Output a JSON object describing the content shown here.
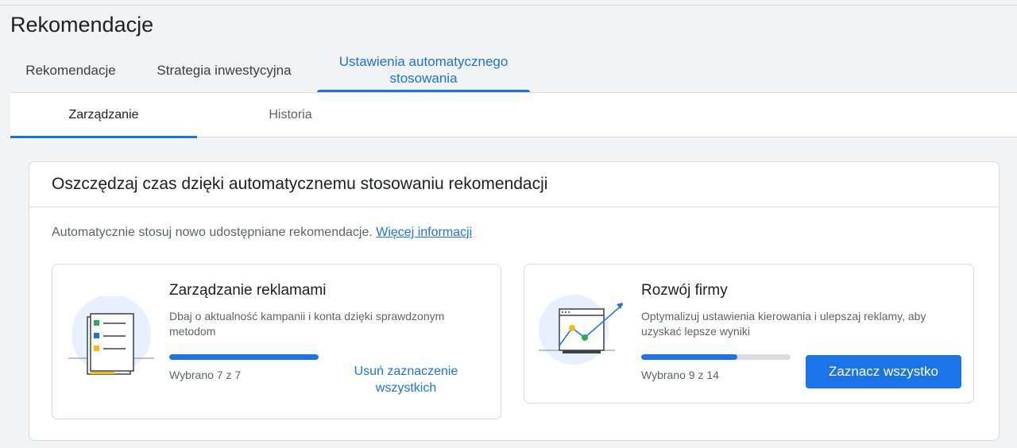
{
  "page": {
    "title": "Rekomendacje"
  },
  "tabs": [
    {
      "label": "Rekomendacje"
    },
    {
      "label": "Strategia inwestycyjna"
    },
    {
      "label": "Ustawienia automatycznego stosowania"
    }
  ],
  "subtabs": [
    {
      "label": "Zarządzanie"
    },
    {
      "label": "Historia"
    }
  ],
  "card": {
    "title": "Oszczędzaj czas dzięki automatycznemu stosowaniu rekomendacji",
    "description": "Automatycznie stosuj nowo udostępniane rekomendacje.",
    "link": "Więcej informacji"
  },
  "ad_management": {
    "title": "Zarządzanie reklamami",
    "description": "Dbaj o aktualność kampanii i konta dzięki sprawdzonym metodom",
    "progress": 1.0,
    "count": "Wybrano 7 z 7",
    "button": "Usuń zaznaczenie wszystkich"
  },
  "business_growth": {
    "title": "Rozwój firmy",
    "description": "Optymalizuj ustawienia kierowania i ulepszaj reklamy, aby uzyskać lepsze wyniki",
    "progress": 0.643,
    "count": "Wybrano 9 z 14",
    "button": "Zaznacz wszystko"
  },
  "colors": {
    "accent": "#1a73e8",
    "checklist_icons": [
      "#34a853",
      "#1a73e8",
      "#fbbc04"
    ]
  }
}
